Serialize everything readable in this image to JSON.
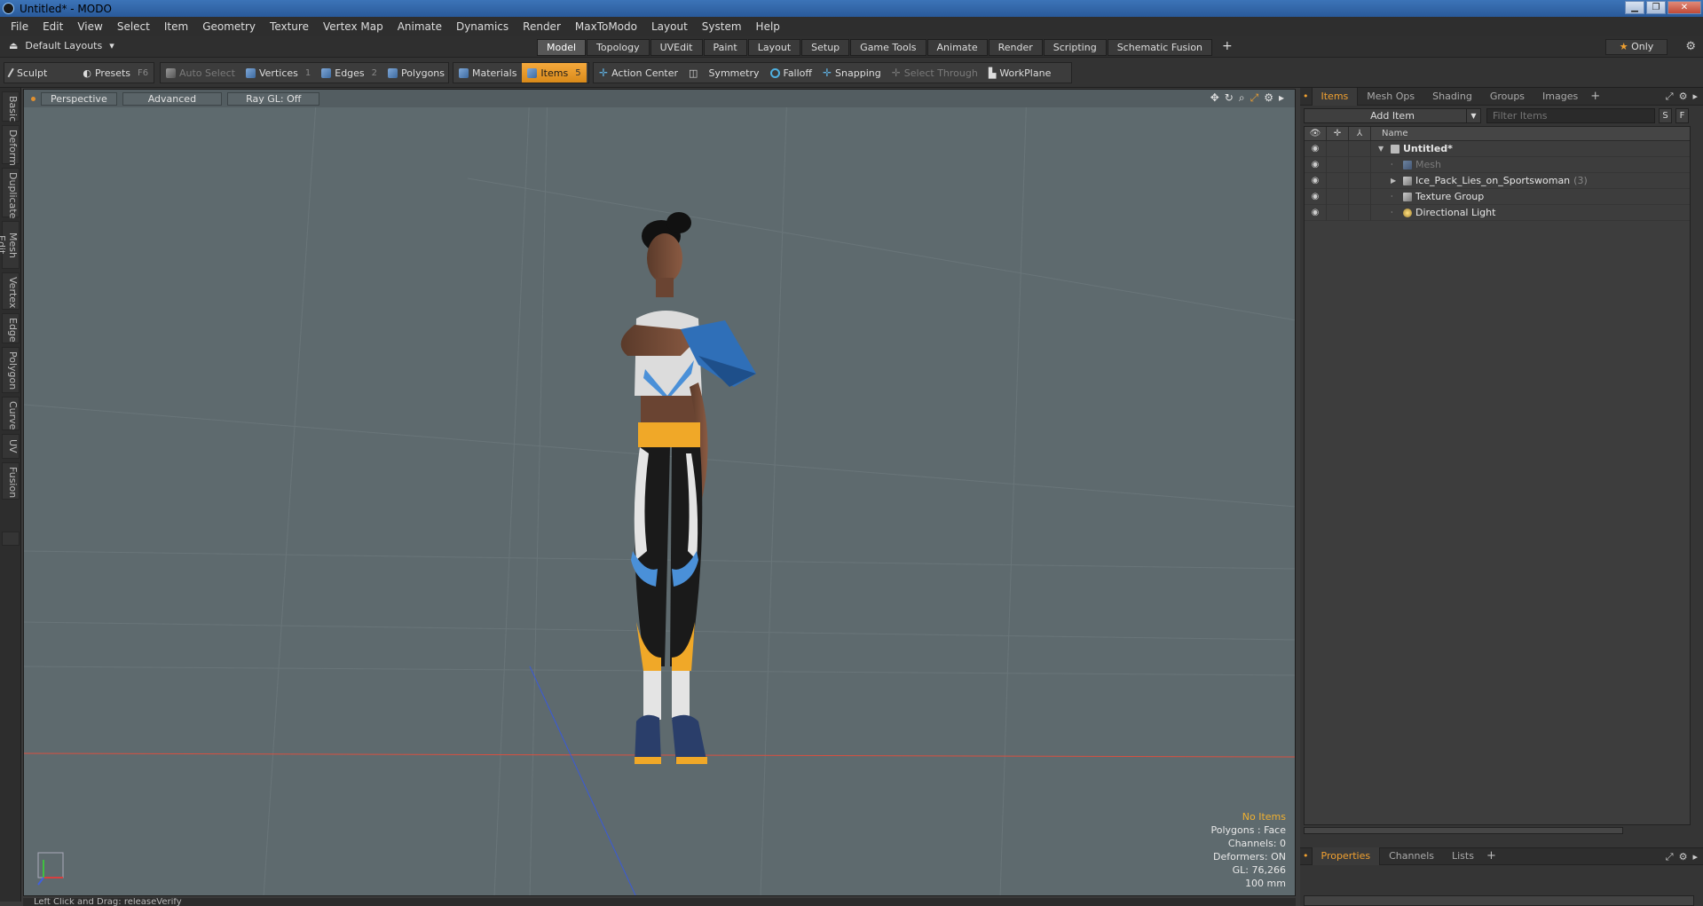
{
  "window": {
    "title": "Untitled* - MODO"
  },
  "menu": [
    "File",
    "Edit",
    "View",
    "Select",
    "Item",
    "Geometry",
    "Texture",
    "Vertex Map",
    "Animate",
    "Dynamics",
    "Render",
    "MaxToModo",
    "Layout",
    "System",
    "Help"
  ],
  "layout_bar": {
    "default_layouts": "Default Layouts",
    "tabs": [
      "Model",
      "Topology",
      "UVEdit",
      "Paint",
      "Layout",
      "Setup",
      "Game Tools",
      "Animate",
      "Render",
      "Scripting",
      "Schematic Fusion"
    ],
    "active_tab": "Model",
    "plus": "+",
    "only": "Only"
  },
  "toolbar": {
    "sculpt": "Sculpt",
    "presets": "Presets",
    "presets_key": "F6",
    "auto_select": "Auto Select",
    "vertices": "Vertices",
    "vertices_key": "1",
    "edges": "Edges",
    "edges_key": "2",
    "polygons": "Polygons",
    "materials": "Materials",
    "items": "Items",
    "items_key": "5",
    "action_center": "Action Center",
    "symmetry": "Symmetry",
    "falloff": "Falloff",
    "snapping": "Snapping",
    "select_through": "Select Through",
    "workplane": "WorkPlane"
  },
  "left_tabs": [
    "Basic",
    "Deform",
    "Duplicate",
    "Mesh Edit",
    "Vertex",
    "Edge",
    "Polygon",
    "Curve",
    "UV",
    "Fusion"
  ],
  "viewport": {
    "view": "Perspective",
    "advanced": "Advanced",
    "raygl": "Ray GL: Off",
    "stats": {
      "no_items": "No Items",
      "polygons": "Polygons : Face",
      "channels": "Channels: 0",
      "deformers": "Deformers: ON",
      "gl": "GL: 76,266",
      "scale": "100 mm"
    },
    "axis_x": "X",
    "axis_z": "Z"
  },
  "status_bar": {
    "text": "Left Click and Drag:  releaseVerify"
  },
  "items_panel": {
    "tabs": [
      "Items",
      "Mesh Ops",
      "Shading",
      "Groups",
      "Images"
    ],
    "active_tab": "Items",
    "plus": "+",
    "add_item": "Add Item",
    "filter_placeholder": "Filter Items",
    "s_btn": "S",
    "f_btn": "F",
    "name_header": "Name",
    "rows": [
      {
        "name": "Untitled*",
        "style": "bold",
        "icon": "scene-icon",
        "twisty": "open",
        "indent": 0
      },
      {
        "name": "Mesh",
        "style": "dim",
        "icon": "mesh-icon",
        "twisty": "",
        "indent": 1
      },
      {
        "name": "Ice_Pack_Lies_on_Sportswoman",
        "count": "(3)",
        "style": "normal",
        "icon": "group-icon",
        "twisty": "closed",
        "indent": 1
      },
      {
        "name": "Texture Group",
        "style": "normal",
        "icon": "texture-group-icon",
        "twisty": "",
        "indent": 1
      },
      {
        "name": "Directional Light",
        "style": "normal",
        "icon": "light-icon",
        "twisty": "",
        "indent": 1
      }
    ]
  },
  "properties_panel": {
    "tabs": [
      "Properties",
      "Channels",
      "Lists"
    ],
    "active_tab": "Properties",
    "plus": "+"
  },
  "colors": {
    "accent": "#f0a030",
    "viewport_bg": "#5e6a6e"
  }
}
